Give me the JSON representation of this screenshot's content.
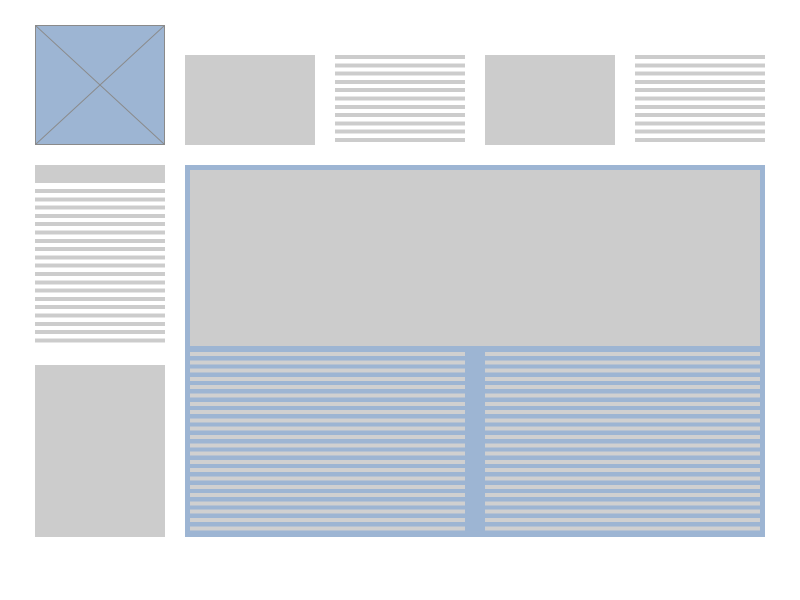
{
  "colors": {
    "placeholder_block": "#cccccc",
    "accent_blue": "#9db5d3",
    "background": "#ffffff",
    "cross_line": "#8a8a8a"
  },
  "header": {
    "logo": {
      "icon": "image-placeholder-icon"
    },
    "items": [
      {
        "kind": "image-block"
      },
      {
        "kind": "text-lines"
      },
      {
        "kind": "image-block"
      },
      {
        "kind": "text-lines"
      }
    ]
  },
  "sidebar": {
    "items": [
      {
        "kind": "heading-bar"
      },
      {
        "kind": "text-lines"
      },
      {
        "kind": "image-block"
      }
    ]
  },
  "main": {
    "hero": {
      "kind": "image-block"
    },
    "columns": [
      {
        "kind": "text-lines"
      },
      {
        "kind": "text-lines"
      }
    ]
  }
}
